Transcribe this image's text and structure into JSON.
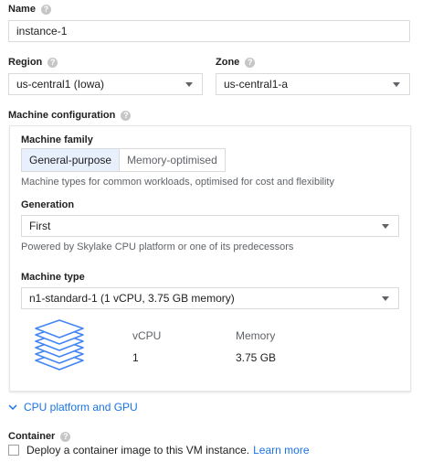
{
  "name": {
    "label": "Name",
    "value": "instance-1"
  },
  "region": {
    "label": "Region",
    "value": "us-central1 (Iowa)"
  },
  "zone": {
    "label": "Zone",
    "value": "us-central1-a"
  },
  "machine_configuration": {
    "label": "Machine configuration",
    "family": {
      "label": "Machine family",
      "options": [
        "General-purpose",
        "Memory-optimised"
      ],
      "selected": "General-purpose",
      "description": "Machine types for common workloads, optimised for cost and flexibility"
    },
    "generation": {
      "label": "Generation",
      "value": "First",
      "description": "Powered by Skylake CPU platform or one of its predecessors"
    },
    "machine_type": {
      "label": "Machine type",
      "value": "n1-standard-1 (1 vCPU, 3.75 GB memory)"
    },
    "stats": {
      "vcpu_label": "vCPU",
      "vcpu_value": "1",
      "memory_label": "Memory",
      "memory_value": "3.75 GB"
    }
  },
  "cpu_platform_link": "CPU platform and GPU",
  "container": {
    "label": "Container",
    "checkbox_label": "Deploy a container image to this VM instance.",
    "learn_more": "Learn more",
    "checked": false
  },
  "icons": {
    "help": "help-circle-icon",
    "dropdown": "caret-down-icon",
    "expand": "chevron-down-icon",
    "machine": "stacked-layers-icon"
  },
  "colors": {
    "accent": "#1a73e8",
    "active_segment_bg": "#e8f0fe",
    "icon_blue": "#4285f4"
  }
}
